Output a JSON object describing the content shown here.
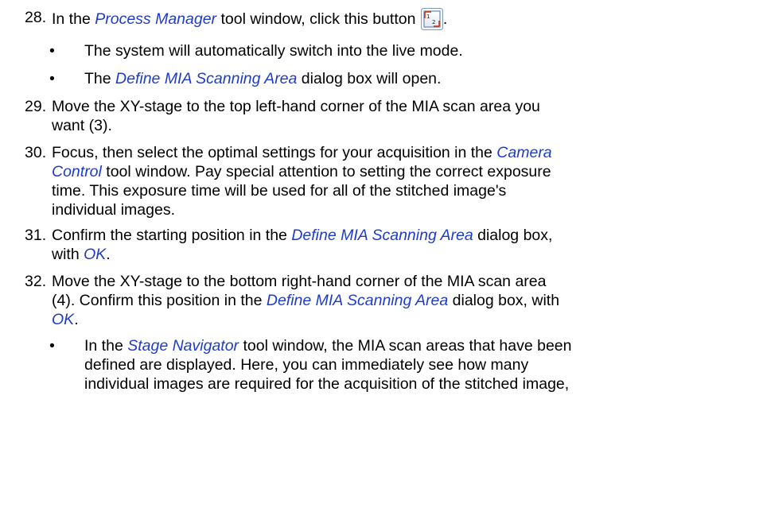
{
  "steps": [
    {
      "number": "28.",
      "pre": "In the ",
      "ref1": "Process Manager",
      "post": " tool window, click this button",
      "end": ".",
      "icon": "define-mia-area-button-icon",
      "bullets": [
        {
          "text": "The system will automatically switch into the live mode."
        },
        {
          "pre": "The ",
          "ref": "Define MIA Scanning Area",
          "post": " dialog box will open."
        }
      ]
    },
    {
      "number": "29.",
      "line1": "Move the XY-stage to the top left-hand corner of the MIA scan area you",
      "line2": "want (3)."
    },
    {
      "number": "30.",
      "line1_pre": "Focus, then select the optimal settings for your acquisition in the ",
      "line1_ref": "Camera",
      "line2_ref": "Control",
      "line2_post": " tool window. Pay special attention to setting the correct exposure",
      "line3": "time. This exposure time will be used for all of the stitched image's",
      "line4": "individual images."
    },
    {
      "number": "31.",
      "line1_pre": "Confirm the starting position in the ",
      "line1_ref": "Define MIA Scanning Area",
      "line1_post": " dialog box,",
      "line2_pre": "with ",
      "line2_ref": "OK",
      "line2_post": "."
    },
    {
      "number": "32.",
      "line1": "Move the XY-stage to the bottom right-hand corner of the MIA scan area",
      "line2_pre": "(4). Confirm this position in the ",
      "line2_ref": "Define MIA Scanning Area",
      "line2_post": " dialog box, with",
      "line3_ref": "OK",
      "line3_post": ".",
      "bullets": [
        {
          "pre": "In the ",
          "ref": "Stage Navigator",
          "post": " tool window, the MIA scan areas that have been",
          "line2": "defined are displayed. Here, you can immediately see how many",
          "line3": "individual images are required for the acquisition of the stitched image,"
        }
      ]
    }
  ],
  "colors": {
    "reference_text": "#1f3cc8",
    "body_text": "#000000"
  }
}
